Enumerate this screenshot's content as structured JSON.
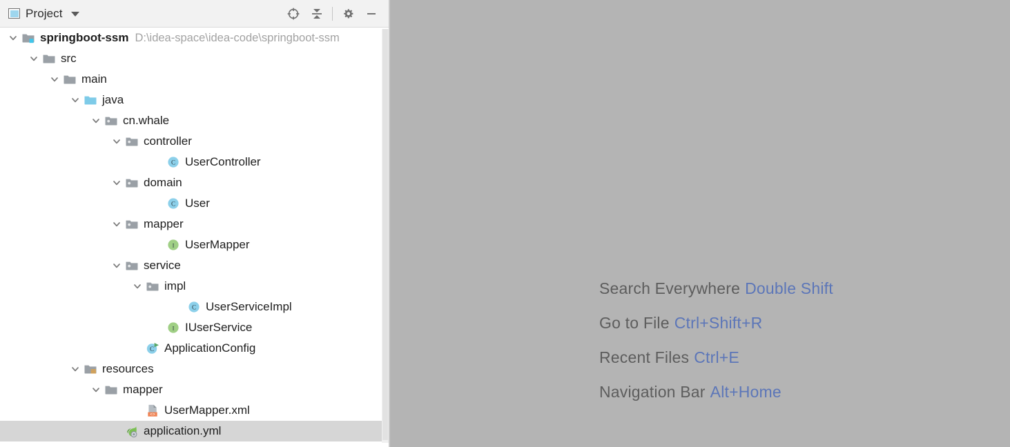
{
  "panel": {
    "title": "Project",
    "icon": "project-window-icon",
    "dropdown_icon": "chevron-down-icon",
    "actions": [
      {
        "name": "select-opened-file-icon",
        "label": "Select Opened File"
      },
      {
        "name": "collapse-all-icon",
        "label": "Collapse All"
      },
      {
        "name": "settings-gear-icon",
        "label": "Settings"
      },
      {
        "name": "hide-panel-icon",
        "label": "Hide"
      }
    ]
  },
  "tree": [
    {
      "depth": 0,
      "label": "springboot-ssm",
      "sub": "D:\\idea-space\\idea-code\\springboot-ssm",
      "icon": "module-folder-icon",
      "twisty": "expanded",
      "bold": true,
      "selected": false
    },
    {
      "depth": 1,
      "label": "src",
      "sub": "",
      "icon": "folder-icon",
      "twisty": "expanded",
      "bold": false,
      "selected": false
    },
    {
      "depth": 2,
      "label": "main",
      "sub": "",
      "icon": "folder-icon",
      "twisty": "expanded",
      "bold": false,
      "selected": false
    },
    {
      "depth": 3,
      "label": "java",
      "sub": "",
      "icon": "source-root-folder-icon",
      "twisty": "expanded",
      "bold": false,
      "selected": false
    },
    {
      "depth": 4,
      "label": "cn.whale",
      "sub": "",
      "icon": "package-icon",
      "twisty": "expanded",
      "bold": false,
      "selected": false
    },
    {
      "depth": 5,
      "label": "controller",
      "sub": "",
      "icon": "package-icon",
      "twisty": "expanded",
      "bold": false,
      "selected": false
    },
    {
      "depth": 7,
      "label": "UserController",
      "sub": "",
      "icon": "java-class-icon",
      "twisty": "none",
      "bold": false,
      "selected": false
    },
    {
      "depth": 5,
      "label": "domain",
      "sub": "",
      "icon": "package-icon",
      "twisty": "expanded",
      "bold": false,
      "selected": false
    },
    {
      "depth": 7,
      "label": "User",
      "sub": "",
      "icon": "java-class-icon",
      "twisty": "none",
      "bold": false,
      "selected": false
    },
    {
      "depth": 5,
      "label": "mapper",
      "sub": "",
      "icon": "package-icon",
      "twisty": "expanded",
      "bold": false,
      "selected": false
    },
    {
      "depth": 7,
      "label": "UserMapper",
      "sub": "",
      "icon": "java-interface-icon",
      "twisty": "none",
      "bold": false,
      "selected": false
    },
    {
      "depth": 5,
      "label": "service",
      "sub": "",
      "icon": "package-icon",
      "twisty": "expanded",
      "bold": false,
      "selected": false
    },
    {
      "depth": 6,
      "label": "impl",
      "sub": "",
      "icon": "package-icon",
      "twisty": "expanded",
      "bold": false,
      "selected": false
    },
    {
      "depth": 8,
      "label": "UserServiceImpl",
      "sub": "",
      "icon": "java-class-icon",
      "twisty": "none",
      "bold": false,
      "selected": false
    },
    {
      "depth": 7,
      "label": "IUserService",
      "sub": "",
      "icon": "java-interface-icon",
      "twisty": "none",
      "bold": false,
      "selected": false
    },
    {
      "depth": 6,
      "label": "ApplicationConfig",
      "sub": "",
      "icon": "runnable-class-icon",
      "twisty": "none",
      "bold": false,
      "selected": false
    },
    {
      "depth": 3,
      "label": "resources",
      "sub": "",
      "icon": "resource-root-folder-icon",
      "twisty": "expanded",
      "bold": false,
      "selected": false
    },
    {
      "depth": 4,
      "label": "mapper",
      "sub": "",
      "icon": "folder-icon",
      "twisty": "expanded",
      "bold": false,
      "selected": false
    },
    {
      "depth": 6,
      "label": "UserMapper.xml",
      "sub": "",
      "icon": "xml-file-icon",
      "twisty": "none",
      "bold": false,
      "selected": false
    },
    {
      "depth": 5,
      "label": "application.yml",
      "sub": "",
      "icon": "spring-yaml-file-icon",
      "twisty": "none",
      "bold": false,
      "selected": true
    }
  ],
  "editor": {
    "shortcuts": [
      {
        "action": "Search Everywhere",
        "keys": "Double Shift"
      },
      {
        "action": "Go to File",
        "keys": "Ctrl+Shift+R"
      },
      {
        "action": "Recent Files",
        "keys": "Ctrl+E"
      },
      {
        "action": "Navigation Bar",
        "keys": "Alt+Home"
      }
    ]
  },
  "colors": {
    "panel_bg": "#ffffff",
    "header_bg": "#f2f2f2",
    "editor_bg": "#b4b4b4",
    "selection_bg": "#d6d6d6",
    "shortcut_key": "#5c76b8",
    "shortcut_text": "#5d5d5d",
    "source_root": "#7ecbe8",
    "class_icon": "#8cd0ea",
    "interface_icon": "#a0cf85",
    "xml_badge": "#ef8354",
    "spring_green": "#6db33f"
  }
}
